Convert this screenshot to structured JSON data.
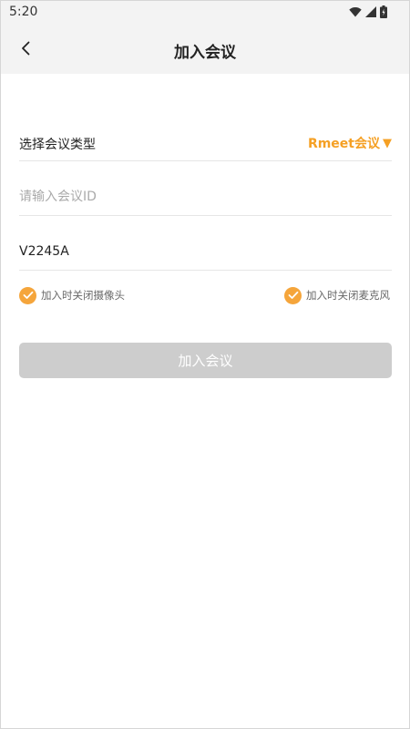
{
  "status_bar": {
    "time": "5:20",
    "icons": [
      "wifi-icon",
      "signal-icon",
      "battery-icon"
    ]
  },
  "header": {
    "title": "加入会议",
    "back_icon": "chevron-left-icon"
  },
  "form": {
    "meeting_type_label": "选择会议类型",
    "meeting_type_value": "Rmeet会议",
    "meeting_type_caret": "▼",
    "meeting_id_placeholder": "请输入会议ID",
    "meeting_id_value": "",
    "display_name_value": "V2245A"
  },
  "options": {
    "camera_off_label": "加入时关闭摄像头",
    "camera_off_checked": true,
    "mic_off_label": "加入时关闭麦克风",
    "mic_off_checked": true
  },
  "actions": {
    "join_label": "加入会议",
    "join_enabled": false
  },
  "colors": {
    "accent": "#f5a024",
    "header_bg": "#f3f3f3",
    "button_disabled": "#cdcdcd",
    "divider": "#e6e6e6"
  }
}
